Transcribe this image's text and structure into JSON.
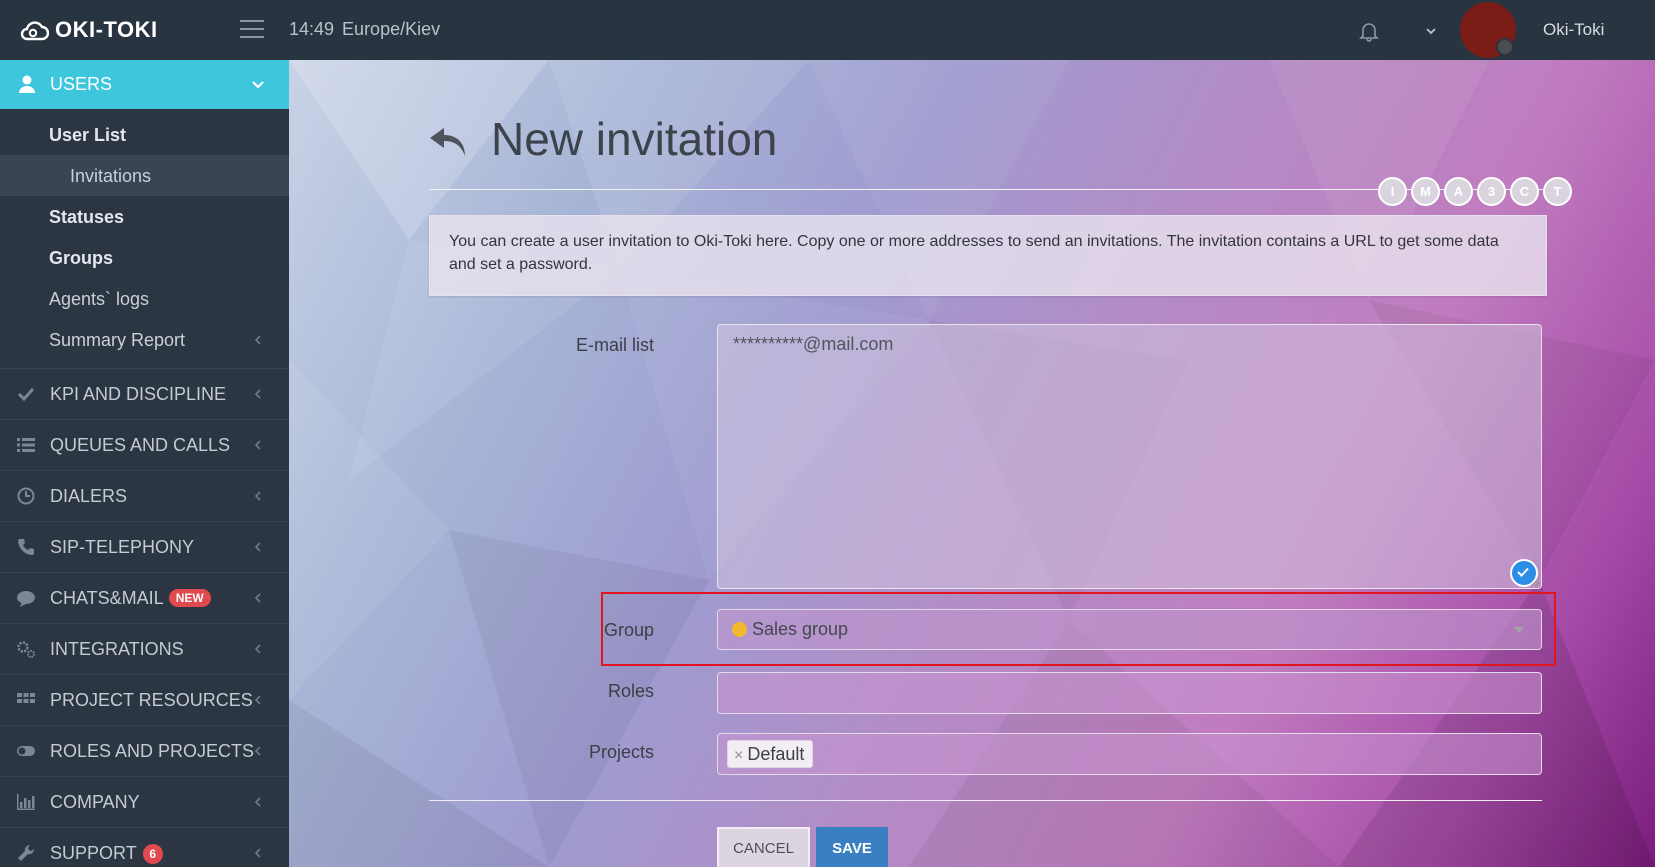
{
  "app": {
    "logo_text": "OKI-TOKI",
    "time": "14:49",
    "timezone": "Europe/Kiev",
    "username": "Oki-Toki"
  },
  "sidebar": {
    "section": {
      "label": "USERS",
      "icon": "user-icon",
      "items": [
        {
          "label": "User List"
        },
        {
          "label": "Invitations"
        },
        {
          "label": "Statuses"
        },
        {
          "label": "Groups"
        },
        {
          "label": "Agents` logs"
        },
        {
          "label": "Summary Report"
        }
      ]
    },
    "menu": [
      {
        "label": "KPI AND DISCIPLINE",
        "icon": "check-icon"
      },
      {
        "label": "QUEUES AND CALLS",
        "icon": "list-icon"
      },
      {
        "label": "DIALERS",
        "icon": "clock-icon"
      },
      {
        "label": "SIP-TELEPHONY",
        "icon": "phone-icon"
      },
      {
        "label": "CHATS&MAIL",
        "icon": "chat-icon",
        "badge": "NEW"
      },
      {
        "label": "INTEGRATIONS",
        "icon": "gears-icon"
      },
      {
        "label": "PROJECT RESOURCES",
        "icon": "grid-icon"
      },
      {
        "label": "ROLES AND PROJECTS",
        "icon": "toggle-icon"
      },
      {
        "label": "COMPANY",
        "icon": "bar-chart-icon"
      },
      {
        "label": "SUPPORT",
        "icon": "wrench-icon",
        "badge": "6"
      }
    ]
  },
  "page": {
    "title": "New invitation",
    "chips": [
      "I",
      "M",
      "A",
      "3",
      "C",
      "T"
    ],
    "info": "You can create a user invitation to Oki-Toki here. Copy one or more addresses to send an invitations. The invitation contains a URL to get some data and set a password."
  },
  "form": {
    "email_label": "E-mail list",
    "email_value": "**********@mail.com",
    "group_label": "Group",
    "group_value": "Sales group",
    "roles_label": "Roles",
    "projects_label": "Projects",
    "project_tag": "Default",
    "cancel_label": "CANCEL",
    "save_label": "SAVE"
  },
  "colors": {
    "accent": "#3ec6dd",
    "highlight": "#e2141e",
    "save": "#3a7fc2",
    "group_dot": "#f2b92e"
  }
}
